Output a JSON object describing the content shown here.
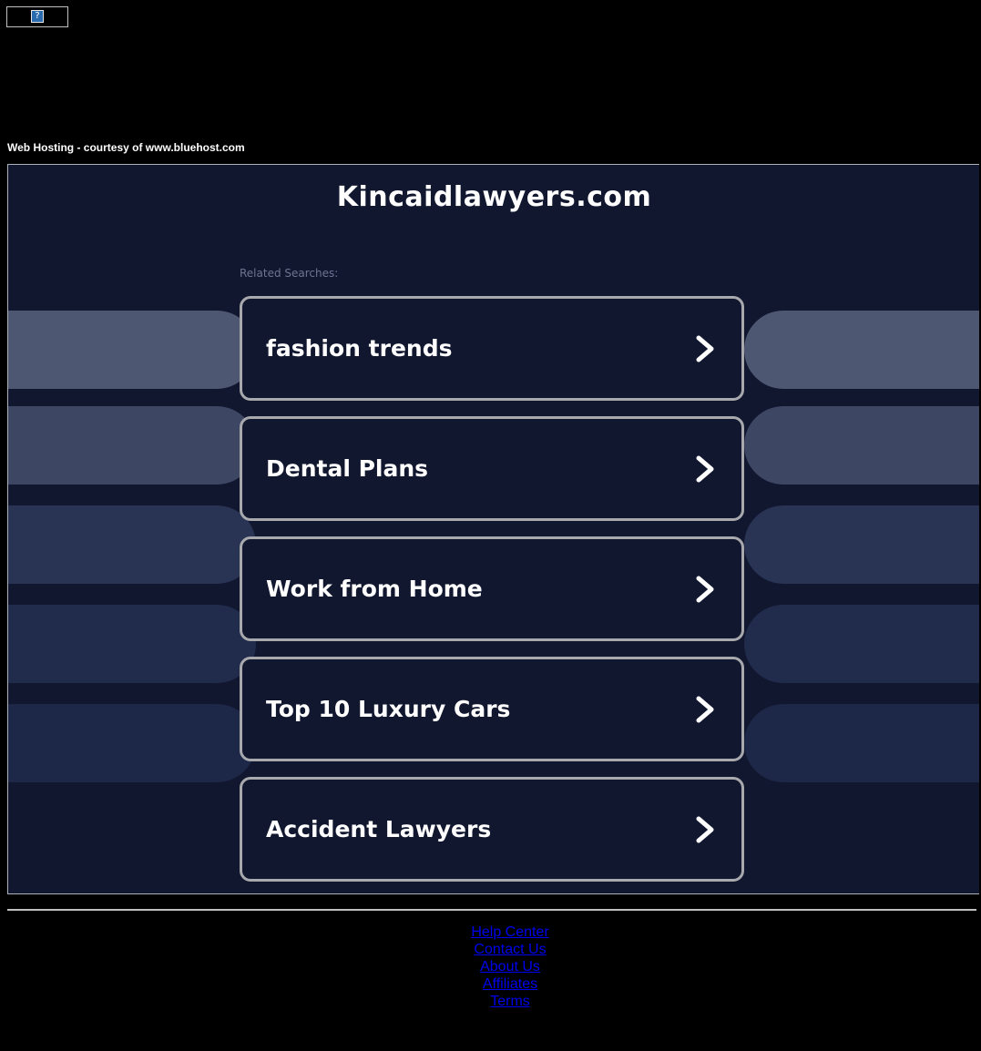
{
  "top_banner": {
    "icon": "broken-image-icon",
    "glyph": "?"
  },
  "hosting_line": "Web Hosting - courtesy of www.bluehost.com",
  "site": {
    "title": "Kincaidlawyers.com",
    "related_label": "Related Searches:"
  },
  "searches": [
    {
      "label": "fashion trends",
      "icon": "chevron-right-icon"
    },
    {
      "label": "Dental Plans",
      "icon": "chevron-right-icon"
    },
    {
      "label": "Work from Home",
      "icon": "chevron-right-icon"
    },
    {
      "label": "Top 10 Luxury Cars",
      "icon": "chevron-right-icon"
    },
    {
      "label": "Accident Lawyers",
      "icon": "chevron-right-icon"
    }
  ],
  "side_pill_colors": [
    "#4e5772",
    "#3d4663",
    "#293353",
    "#212c4d",
    "#1d2848"
  ],
  "colors": {
    "page_background": "#000000",
    "frame_background": "#121730",
    "card_border": "#a8a9ad",
    "link": "#0000ee"
  },
  "footer": {
    "links": [
      "Help Center",
      "Contact Us",
      "About Us",
      "Affiliates",
      "Terms"
    ]
  }
}
